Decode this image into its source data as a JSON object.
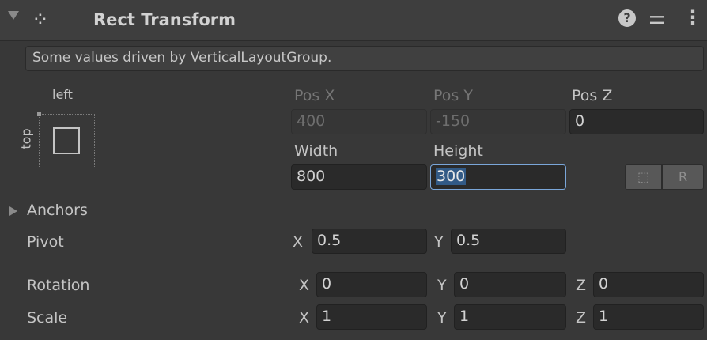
{
  "header": {
    "title": "Rect Transform",
    "icons": [
      "foldout-arrow",
      "rect-transform-icon",
      "help-icon",
      "preset-icon",
      "kebab-menu-icon"
    ],
    "help_glyph": "?",
    "preset_glyph": "⚌",
    "menu_glyph": "⋮",
    "component_glyph": "⁘"
  },
  "helpbox": {
    "text": "Some values driven by VerticalLayoutGroup."
  },
  "anchor_preset": {
    "left_label": "left",
    "top_label": "top"
  },
  "position": {
    "posx_label": "Pos X",
    "posx_value": "400",
    "posy_label": "Pos Y",
    "posy_value": "-150",
    "posz_label": "Pos Z",
    "posz_value": "0",
    "width_label": "Width",
    "width_value": "800",
    "height_label": "Height",
    "height_value": "300"
  },
  "buttons": {
    "blueprint_glyph": "⬚",
    "raw_label": "R"
  },
  "anchors": {
    "label": "Anchors"
  },
  "pivot": {
    "label": "Pivot",
    "x_label": "X",
    "x_value": "0.5",
    "y_label": "Y",
    "y_value": "0.5"
  },
  "rotation": {
    "label": "Rotation",
    "x_label": "X",
    "x_value": "0",
    "y_label": "Y",
    "y_value": "0",
    "z_label": "Z",
    "z_value": "0"
  },
  "scale": {
    "label": "Scale",
    "x_label": "X",
    "x_value": "1",
    "y_label": "Y",
    "y_value": "1",
    "z_label": "Z",
    "z_value": "1"
  },
  "colors": {
    "background": "#383838",
    "field": "#2a2a2a",
    "focus_border": "#7aa6d9",
    "selection": "#325a86"
  }
}
